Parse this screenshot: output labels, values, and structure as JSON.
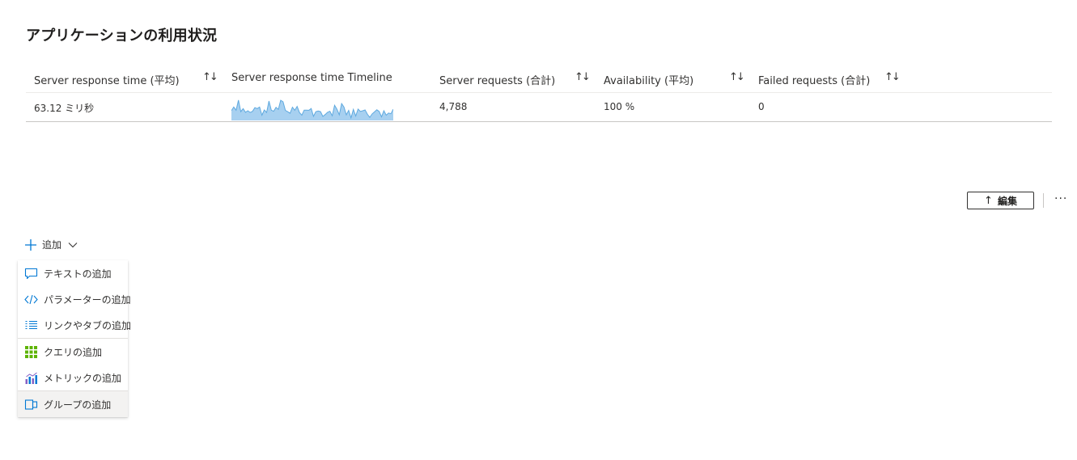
{
  "page": {
    "title": "アプリケーションの利用状況"
  },
  "grid": {
    "columns": [
      {
        "label": "Server response time (平均)"
      },
      {
        "label": "Server response time Timeline"
      },
      {
        "label": "Server requests (合計)"
      },
      {
        "label": "Availability (平均)"
      },
      {
        "label": "Failed requests (合計)"
      }
    ],
    "sort_glyph": "↑↓",
    "row": {
      "response_time": "63.12 ミリ秒",
      "requests": "4,788",
      "availability": "100 %",
      "failed": "0"
    },
    "sparkline_color": "#5ea9df"
  },
  "toolbar": {
    "edit_label": "編集",
    "more_label": "···"
  },
  "add": {
    "label": "追加"
  },
  "menu": {
    "items": [
      {
        "label": "テキストの追加",
        "icon": "speech-bubble-icon"
      },
      {
        "label": "パラメーターの追加",
        "icon": "code-brackets-icon"
      },
      {
        "label": "リンクやタブの追加",
        "icon": "list-icon"
      },
      {
        "label": "クエリの追加",
        "icon": "grid-icon"
      },
      {
        "label": "メトリックの追加",
        "icon": "bar-chart-icon"
      },
      {
        "label": "グループの追加",
        "icon": "group-icon"
      }
    ]
  },
  "colors": {
    "accent": "#0078d4",
    "query_green": "#5db300",
    "metric_purple": "#8661c5"
  }
}
